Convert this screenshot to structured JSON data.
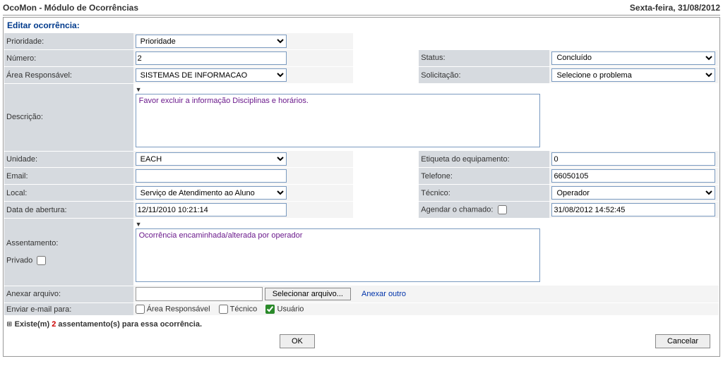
{
  "titlebar": {
    "left": "OcoMon - Módulo de Ocorrências",
    "right": "Sexta-feira, 31/08/2012"
  },
  "section_title": "Editar ocorrência:",
  "labels": {
    "prioridade": "Prioridade:",
    "numero": "Número:",
    "area": "Área Responsável:",
    "descricao": "Descrição:",
    "unidade": "Unidade:",
    "email": "Email:",
    "local": "Local:",
    "data_abertura": "Data de abertura:",
    "assentamento": "Assentamento:",
    "privado": "Privado",
    "anexar": "Anexar arquivo:",
    "enviar_email": "Enviar e-mail para:",
    "status": "Status:",
    "solicitacao": "Solicitação:",
    "etiqueta": "Etiqueta do equipamento:",
    "telefone": "Telefone:",
    "tecnico": "Técnico:",
    "agendar": "Agendar o chamado:"
  },
  "values": {
    "prioridade": "Prioridade",
    "numero": "2",
    "area": "SISTEMAS DE INFORMACAO",
    "descricao": "Favor excluir a informação Disciplinas e horários.",
    "unidade": "EACH",
    "email": "",
    "local": "Serviço de Atendimento ao Aluno",
    "data_abertura": "12/11/2010 10:21:14",
    "assentamento": "Ocorrência encaminhada/alterada por operador",
    "status": "Concluído",
    "solicitacao": "Selecione o problema",
    "etiqueta": "0",
    "telefone": "66050105",
    "tecnico": "Operador",
    "agendar_data": "31/08/2012 14:52:45"
  },
  "file": {
    "button": "Selecionar arquivo...",
    "link": "Anexar outro"
  },
  "email_checks": {
    "area": "Área Responsável",
    "tecnico": "Técnico",
    "usuario": "Usuário"
  },
  "footer": {
    "prefix": "Existe(m)",
    "count": "2",
    "suffix": "assentamento(s) para essa ocorrência."
  },
  "buttons": {
    "ok": "OK",
    "cancel": "Cancelar"
  }
}
